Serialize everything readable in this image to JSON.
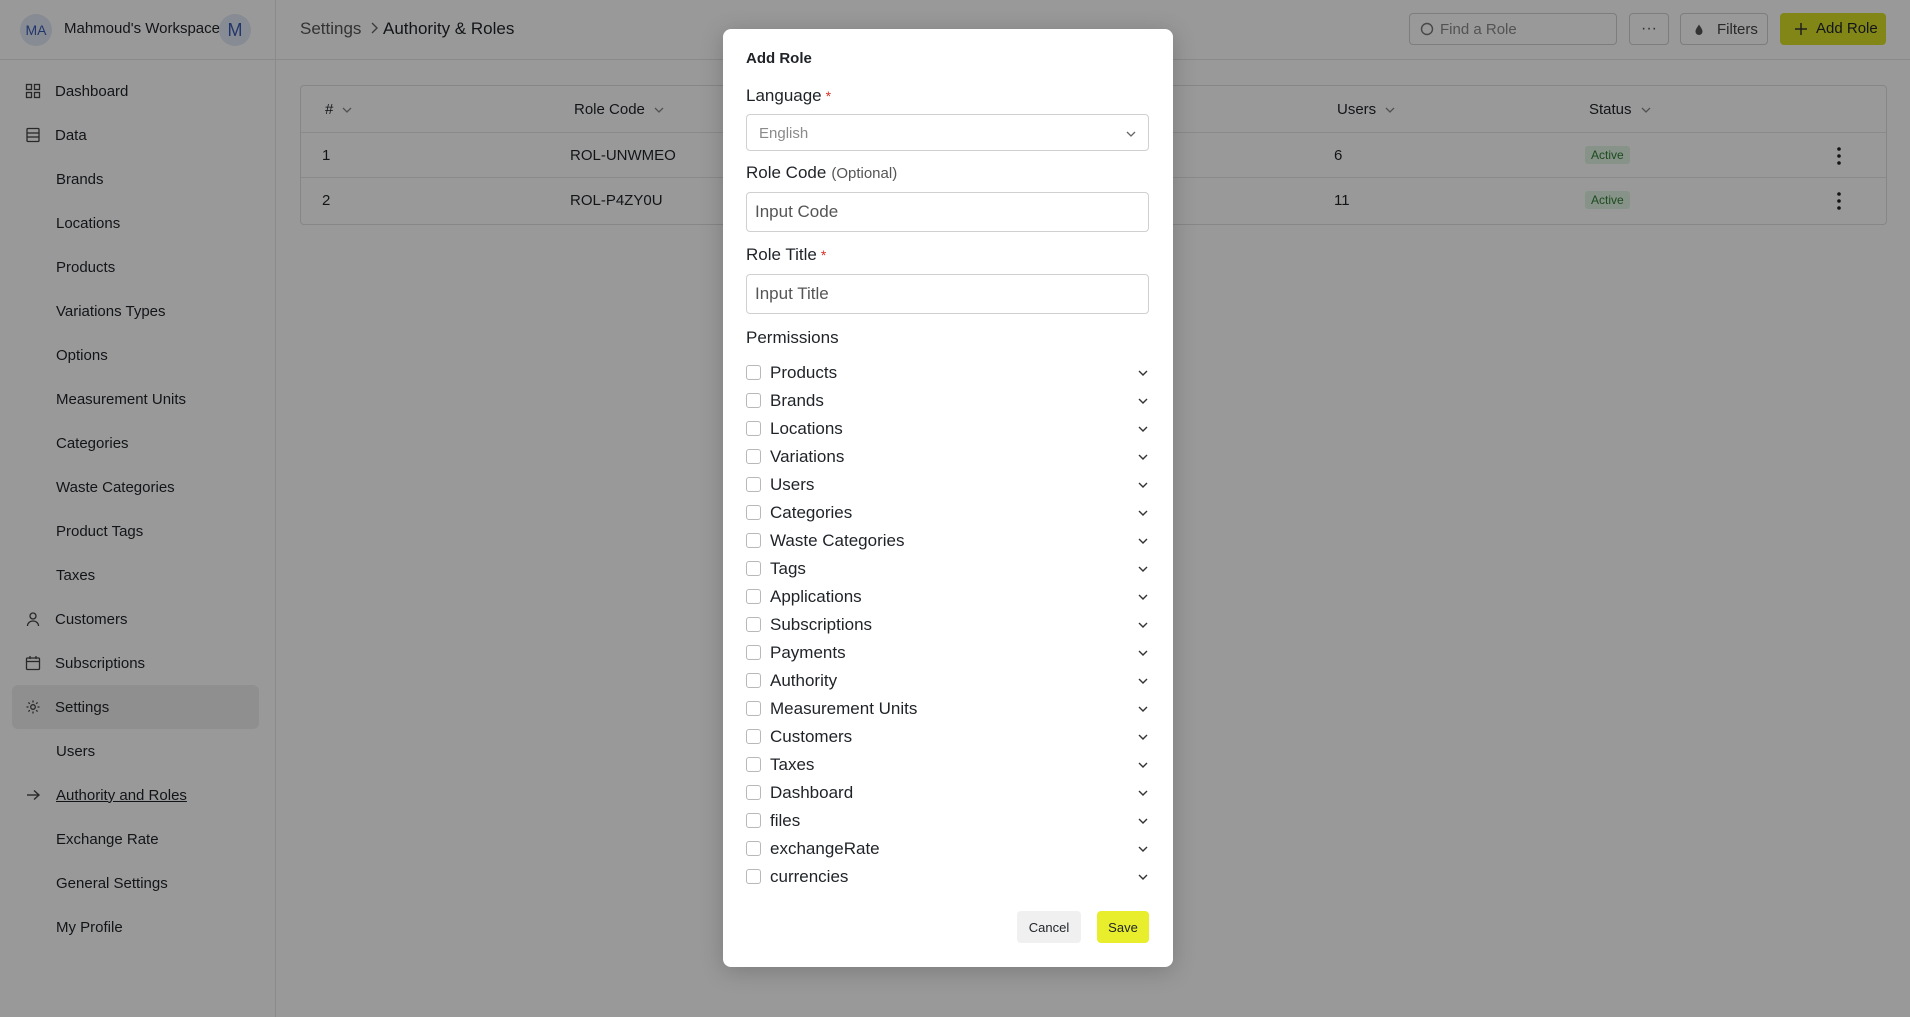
{
  "workspace": {
    "avatar_initials": "MA",
    "name": "Mahmoud's Workspace",
    "user_initial": "M"
  },
  "sidebar": {
    "items": [
      {
        "label": "Dashboard",
        "icon": "grid-icon"
      },
      {
        "label": "Data",
        "icon": "database-icon"
      },
      {
        "label": "Brands"
      },
      {
        "label": "Locations"
      },
      {
        "label": "Products"
      },
      {
        "label": "Variations Types"
      },
      {
        "label": "Options"
      },
      {
        "label": "Measurement Units"
      },
      {
        "label": "Categories"
      },
      {
        "label": "Waste Categories"
      },
      {
        "label": "Product Tags"
      },
      {
        "label": "Taxes"
      },
      {
        "label": "Customers",
        "icon": "person-icon"
      },
      {
        "label": "Subscriptions",
        "icon": "calendar-icon"
      },
      {
        "label": "Settings",
        "icon": "gear-icon",
        "active": true
      },
      {
        "label": "Users"
      },
      {
        "label": "Authority and Roles",
        "icon": "arrow-right-icon",
        "current": true
      },
      {
        "label": "Exchange Rate"
      },
      {
        "label": "General Settings"
      },
      {
        "label": "My Profile"
      }
    ]
  },
  "header": {
    "breadcrumb": [
      "Settings",
      "Authority & Roles"
    ],
    "search_placeholder": "Find a Role",
    "filters_label": "Filters",
    "add_label": "Add Role"
  },
  "table": {
    "columns": [
      "#",
      "Role Code",
      "Users",
      "Status"
    ],
    "rows": [
      {
        "num": "1",
        "code": "ROL-UNWMEO",
        "users": "6",
        "status": "Active"
      },
      {
        "num": "2",
        "code": "ROL-P4ZY0U",
        "users": "11",
        "status": "Active"
      }
    ]
  },
  "modal": {
    "title": "Add Role",
    "language_label": "Language",
    "language_required": "*",
    "language_value": "English",
    "code_label": "Role Code",
    "code_optional": "(Optional)",
    "code_placeholder": "Input Code",
    "title_label": "Role Title",
    "title_required": "*",
    "title_placeholder": "Input Title",
    "permissions_label": "Permissions",
    "permissions": [
      "Products",
      "Brands",
      "Locations",
      "Variations",
      "Users",
      "Categories",
      "Waste Categories",
      "Tags",
      "Applications",
      "Subscriptions",
      "Payments",
      "Authority",
      "Measurement Units",
      "Customers",
      "Taxes",
      "Dashboard",
      "files",
      "exchangeRate",
      "currencies"
    ],
    "cancel_label": "Cancel",
    "save_label": "Save"
  },
  "colors": {
    "accent": "#d9e026",
    "active_badge_bg": "#e2f5e4",
    "active_badge_text": "#2e7d32"
  }
}
